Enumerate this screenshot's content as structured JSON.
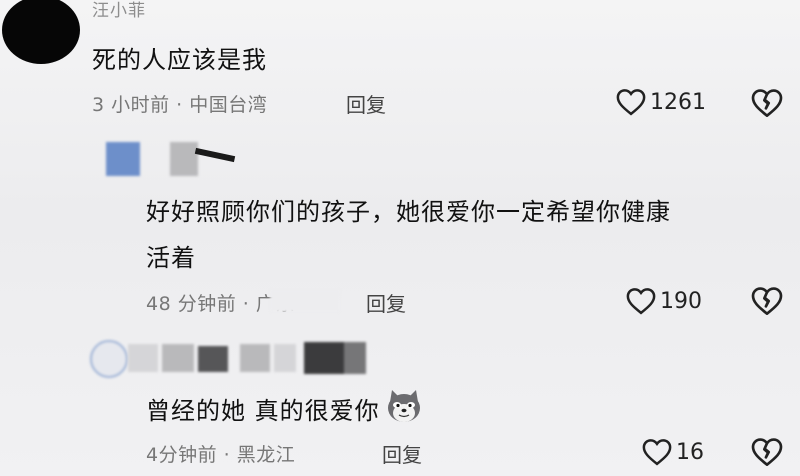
{
  "comments": [
    {
      "username": "汪小菲",
      "text": "死的人应该是我",
      "time_location": "3 小时前 · 中国台湾",
      "reply_label": "回复",
      "likes": "1261"
    },
    {
      "username": "",
      "text_line1": "好好照顾你们的孩子，她很爱你一定希望你健康",
      "text_line2": "活着",
      "time_location": "48 分钟前 · 广东",
      "reply_label": "回复",
      "likes": "190"
    },
    {
      "username": "",
      "text": "曾经的她 真的很爱你",
      "time_location": "4分钟前 · 黑龙江",
      "reply_label": "回复",
      "likes": "16"
    }
  ],
  "icons": {
    "like": "heart-outline-icon",
    "dislike": "broken-heart-icon",
    "emoji": "dog-face-emoji"
  },
  "colors": {
    "background": "#f0f0f2",
    "meta_text": "#777777",
    "avatar_blue": "#6d8fca"
  }
}
